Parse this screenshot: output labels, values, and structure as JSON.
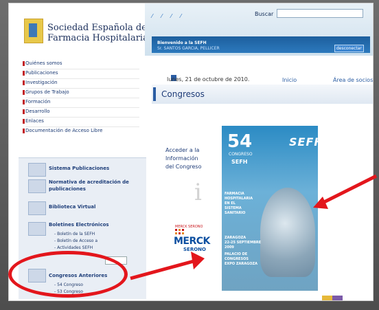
{
  "org": {
    "line1": "Sociedad Española de",
    "line2": "Farmacia Hospitalaria"
  },
  "header": {
    "languages": "⁄ ⁄ ⁄ ⁄",
    "search_label": "Buscar",
    "search_value": "",
    "welcome_title": "Bienvenido a la SEFH",
    "welcome_user": "Sr. SANTOS GARCIA, PELLICER",
    "logout_label": "desconectar",
    "date_text": "lunes, 21 de octubre de 2010.",
    "inicio_label": "Inicio",
    "socios_label": "Área de socios"
  },
  "menu": {
    "items": [
      {
        "label": "Quiénes somos"
      },
      {
        "label": "Publicaciones"
      },
      {
        "label": "Investigación"
      },
      {
        "label": "Grupos de Trabajo"
      },
      {
        "label": "Formación"
      },
      {
        "label": "Desarrollo"
      },
      {
        "label": "Enlaces"
      },
      {
        "label": "Documentación de Acceso Libre"
      }
    ]
  },
  "sidebar": {
    "items": [
      {
        "label": "Sistema Publicaciones"
      },
      {
        "label": "Normativa de acreditación de"
      },
      {
        "label": "publicaciones"
      },
      {
        "label": "Biblioteca Virtual"
      },
      {
        "label": "Boletines Electrónicos"
      },
      {
        "label": "Congresos Anteriores"
      }
    ],
    "sub": [
      "- Boletín de la SEFH",
      "- Boletín de Acceso a",
      "- Actividades SEFH",
      "- 54 Congreso",
      "- 53 Congreso"
    ]
  },
  "main": {
    "section_title": "Congresos",
    "acceder_lines": [
      "Acceder a la",
      "Información",
      "del Congreso"
    ],
    "merck_top": "MERCK SERONO",
    "merck": "MERCK",
    "serono": "SERONO",
    "poster": {
      "number": "54",
      "congreso": "CONGRESO",
      "sefh": "SEFH",
      "logo": "SEFH",
      "lines": [
        "FARMACIA",
        "HOSPITALARIA",
        "EN EL",
        "SISTEMA",
        "SANITARIO",
        "ZARAGOZA",
        "22-25 SEPTIEMBRE",
        "2009",
        "PALACIO DE",
        "CONGRESOS",
        "EXPO ZARAGOZA"
      ]
    }
  },
  "colors": {
    "accent_red": "#e3161c",
    "brand_blue": "#2b5da3"
  }
}
